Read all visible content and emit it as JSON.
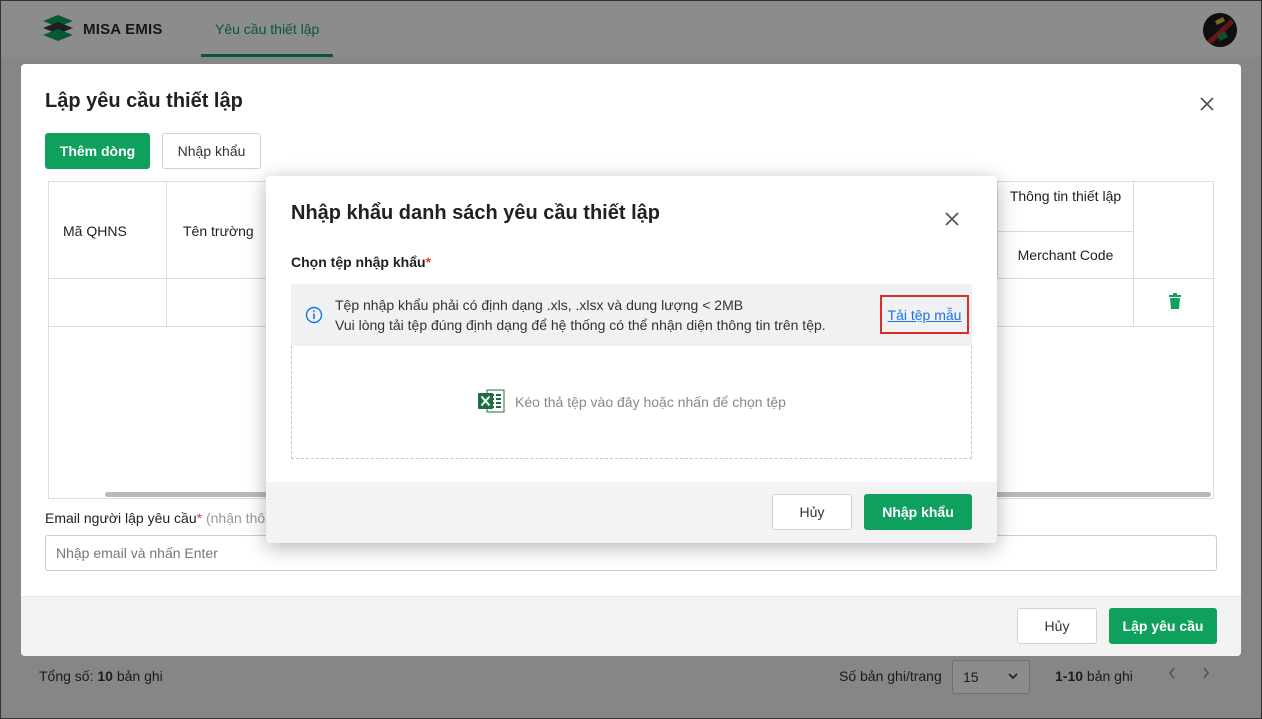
{
  "app": {
    "brand": "MISA EMIS",
    "nav_tab": "Yêu cầu thiết lập"
  },
  "footer": {
    "total_label": "Tổng số:",
    "total_count": "10",
    "total_unit": "bản ghi",
    "per_page_label": "Số bản ghi/trang",
    "per_page_value": "15",
    "range_value": "1-10",
    "range_unit": "bản ghi"
  },
  "outer_dialog": {
    "title": "Lập yêu cầu thiết lập",
    "add_row_label": "Thêm dòng",
    "import_label": "Nhập khẩu",
    "columns": {
      "code": "Mã QHNS",
      "school": "Tên trường",
      "setup_info": "Thông tin thiết lập",
      "merchant": "Merchant Code"
    },
    "email_label": "Email người lập yêu cầu",
    "email_hint": "(nhận thô",
    "email_placeholder": "Nhập email và nhấn Enter",
    "cancel_label": "Hủy",
    "create_label": "Lập yêu cầu"
  },
  "modal": {
    "title": "Nhập khẩu danh sách yêu cầu thiết lập",
    "file_label": "Chọn tệp nhập khẩu",
    "info_line1": "Tệp nhập khẩu phải có định dạng .xls, .xlsx và dung lượng < 2MB",
    "info_line2": "Vui lòng tải tệp đúng định dạng để hệ thống có thể nhận diện thông tin trên tệp.",
    "download_label": "Tải tệp mẫu",
    "drop_text": "Kéo thả tệp vào đây hoặc nhấn để chọn tệp",
    "cancel_label": "Hủy",
    "import_label": "Nhập khẩu"
  },
  "colors": {
    "primary": "#0fa05e",
    "link": "#1a73e8",
    "highlight": "#e02b2b"
  },
  "icons": [
    "logo-icon",
    "avatar",
    "close-icon",
    "trash-icon",
    "info-icon",
    "excel-icon",
    "chevron-down-icon",
    "chevron-left-icon",
    "chevron-right-icon"
  ]
}
